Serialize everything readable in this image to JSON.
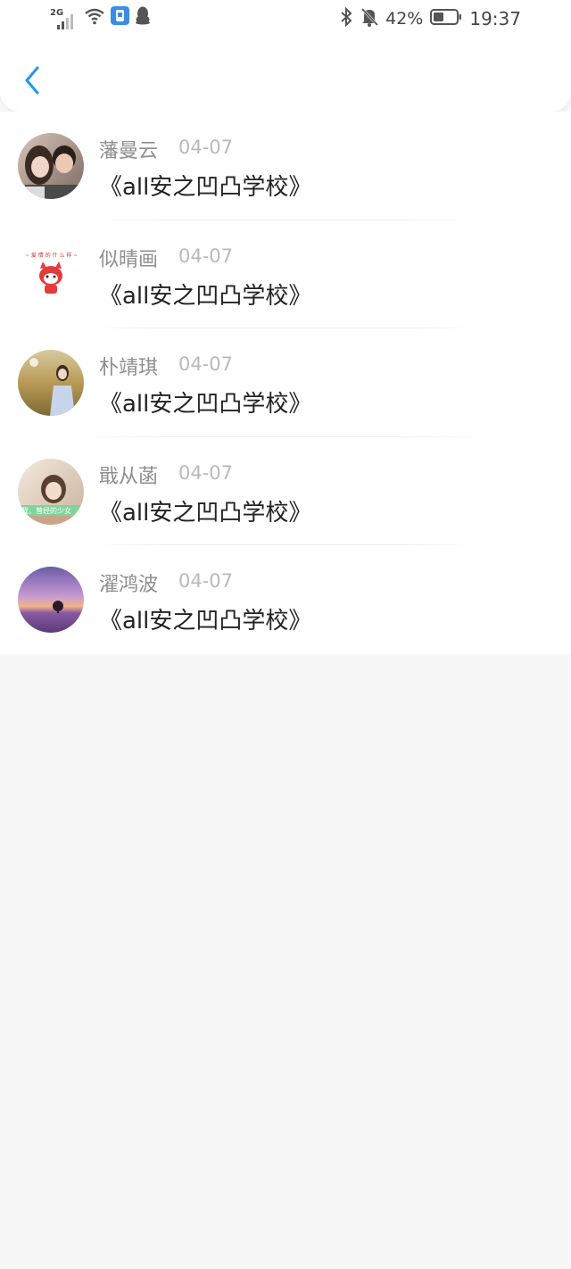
{
  "status_bar": {
    "network_label": "2G",
    "battery_percent": "42%",
    "time": "19:37"
  },
  "header": {
    "back_icon": "chevron-left-icon",
    "accent_color": "#2196f3"
  },
  "items": [
    {
      "name": "藩曼云",
      "date": "04-07",
      "title": "《all安之凹凸学校》"
    },
    {
      "name": "似晴画",
      "date": "04-07",
      "title": "《all安之凹凸学校》"
    },
    {
      "name": "朴靖琪",
      "date": "04-07",
      "title": "《all安之凹凸学校》"
    },
    {
      "name": "戢从菡",
      "date": "04-07",
      "title": "《all安之凹凸学校》"
    },
    {
      "name": "濯鸿波",
      "date": "04-07",
      "title": "《all安之凹凸学校》"
    }
  ]
}
